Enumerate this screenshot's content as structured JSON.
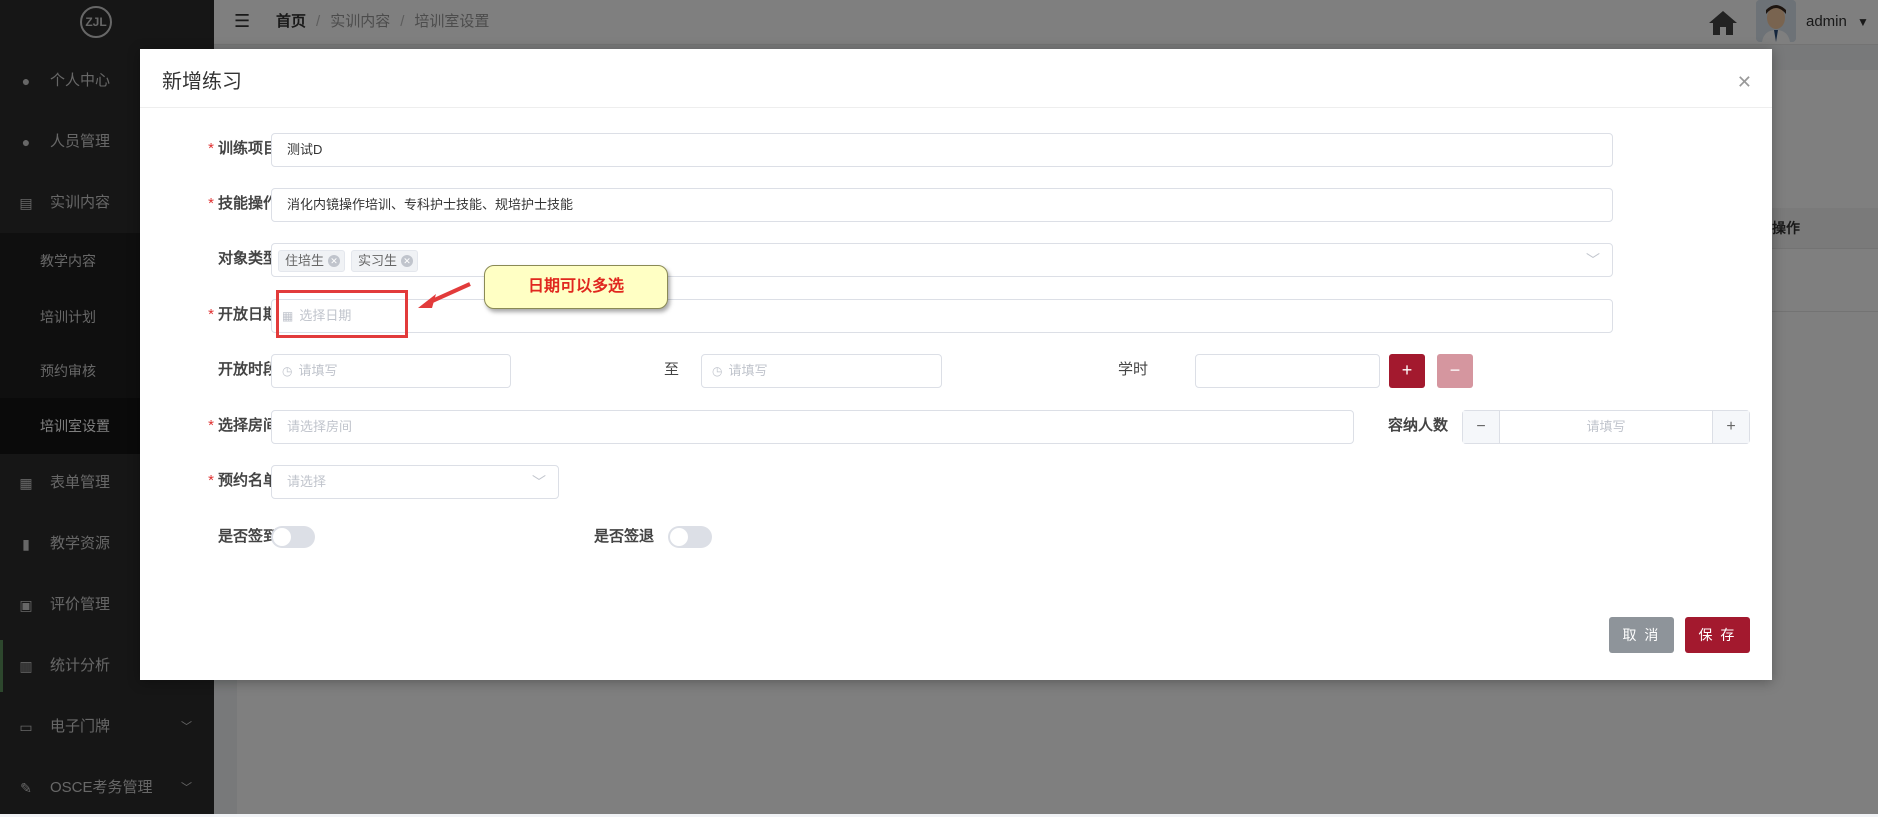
{
  "sidebar": {
    "logo_text": "ZJL",
    "items": [
      {
        "label": "个人中心",
        "icon": "person-icon"
      },
      {
        "label": "人员管理",
        "icon": "people-icon"
      },
      {
        "label": "实训内容",
        "icon": "content-icon"
      },
      {
        "label": "表单管理",
        "icon": "form-icon"
      },
      {
        "label": "教学资源",
        "icon": "resource-icon"
      },
      {
        "label": "评价管理",
        "icon": "evaluation-icon"
      },
      {
        "label": "统计分析",
        "icon": "chart-icon"
      },
      {
        "label": "电子门牌",
        "icon": "doorplate-icon"
      },
      {
        "label": "OSCE考务管理",
        "icon": "osce-icon"
      }
    ],
    "sub_items": [
      {
        "label": "教学内容"
      },
      {
        "label": "培训计划"
      },
      {
        "label": "预约审核"
      },
      {
        "label": "培训室设置",
        "active": true
      }
    ]
  },
  "header": {
    "breadcrumb": [
      "首页",
      "实训内容",
      "培训室设置"
    ],
    "user": "admin"
  },
  "background_table": {
    "column": "操作"
  },
  "dialog": {
    "title": "新增练习",
    "fields": {
      "training_item": {
        "label": "训练项目",
        "value": "测试D"
      },
      "skill": {
        "label": "技能操作",
        "value": "消化内镜操作培训、专科护士技能、规培护士技能"
      },
      "target_type": {
        "label": "对象类型",
        "tags": [
          "住培生",
          "实习生"
        ]
      },
      "open_date": {
        "label": "开放日期",
        "placeholder": "选择日期"
      },
      "open_period": {
        "label": "开放时段",
        "start_placeholder": "请填写",
        "to": "至",
        "end_placeholder": "请填写",
        "hours_label": "学时",
        "hours_value": ""
      },
      "room": {
        "label": "选择房间",
        "placeholder": "请选择房间"
      },
      "capacity": {
        "label": "容纳人数",
        "placeholder": "请填写"
      },
      "booking_list": {
        "label": "预约名单",
        "placeholder": "请选择"
      },
      "sign_in": {
        "label": "是否签到",
        "on": false
      },
      "sign_out": {
        "label": "是否签退",
        "on": false
      }
    },
    "annotation": "日期可以多选",
    "buttons": {
      "cancel": "取 消",
      "save": "保 存"
    }
  },
  "colors": {
    "primary": "#a3192e",
    "primary_disabled": "#d5969f",
    "cancel": "#8e949a",
    "sidebar_bg": "#2d2d2d"
  }
}
